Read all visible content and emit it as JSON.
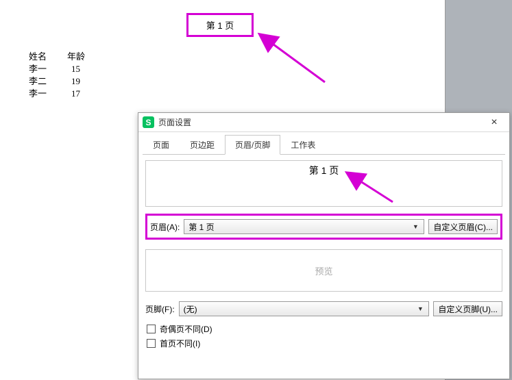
{
  "document": {
    "page_number_label": "第 1 页",
    "table": {
      "headers": [
        "姓名",
        "年龄"
      ],
      "rows": [
        [
          "李一",
          "15"
        ],
        [
          "李二",
          "19"
        ],
        [
          "李一",
          "17"
        ]
      ]
    }
  },
  "dialog": {
    "title": "页面设置",
    "close_symbol": "×",
    "tabs": [
      {
        "label": "页面",
        "active": false
      },
      {
        "label": "页边距",
        "active": false
      },
      {
        "label": "页眉/页脚",
        "active": true
      },
      {
        "label": "工作表",
        "active": false
      }
    ],
    "header_preview_text": "第 1 页",
    "header_field": {
      "label": "页眉(A):",
      "value": "第 1 页",
      "custom_button": "自定义页眉(C)..."
    },
    "preview_placeholder": "预览",
    "footer_field": {
      "label": "页脚(F):",
      "value": "(无)",
      "custom_button": "自定义页脚(U)..."
    },
    "options": {
      "odd_even_different": "奇偶页不同(D)",
      "first_page_different": "首页不同(I)"
    }
  }
}
